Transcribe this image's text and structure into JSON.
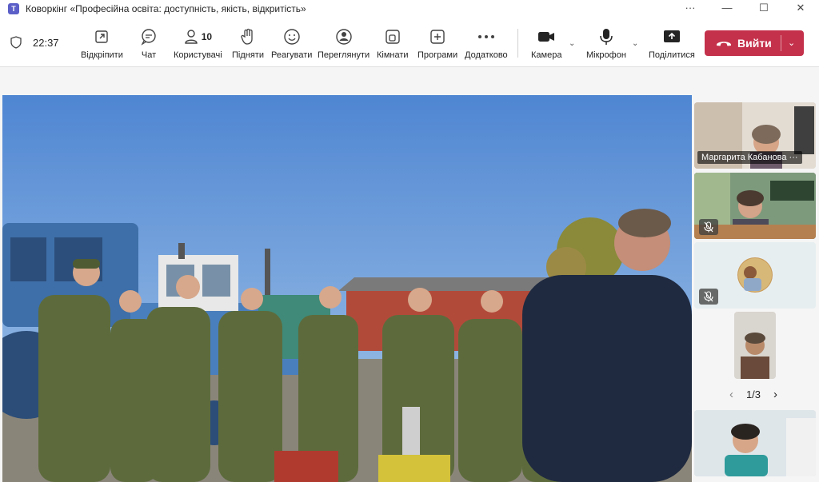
{
  "window": {
    "title": "Коворкінг «Професійна освіта: доступність, якість, відкритість»",
    "controls": [
      "···",
      "—",
      "☐",
      "✕"
    ]
  },
  "meeting": {
    "time": "22:37"
  },
  "toolbar": {
    "buttons": [
      {
        "label": "Відкріпити",
        "icon": "unpin-icon"
      },
      {
        "label": "Чат",
        "icon": "chat-icon"
      },
      {
        "label": "Користувачі",
        "icon": "people-icon",
        "count": "10"
      },
      {
        "label": "Підняти",
        "icon": "raise-hand-icon"
      },
      {
        "label": "Реагувати",
        "icon": "react-icon"
      },
      {
        "label": "Переглянути",
        "icon": "view-icon"
      },
      {
        "label": "Кімнати",
        "icon": "rooms-icon"
      },
      {
        "label": "Програми",
        "icon": "apps-icon"
      },
      {
        "label": "Додатково",
        "icon": "more-icon"
      },
      {
        "label": "Камера",
        "icon": "camera-icon"
      },
      {
        "label": "Мікрофон",
        "icon": "mic-icon"
      },
      {
        "label": "Поділитися",
        "icon": "share-icon"
      }
    ],
    "leave_label": "Вийти"
  },
  "participants": [
    {
      "name": "Маргарита Кабанова",
      "more": "···"
    },
    {
      "name": "",
      "muted": true
    },
    {
      "name": "",
      "muted": true
    },
    {
      "name": ""
    },
    {
      "name": ""
    }
  ],
  "pager": {
    "text": "1/3",
    "prev": "‹",
    "next": "›"
  },
  "colors": {
    "leave": "#c4314b",
    "accent": "#5b5fc7"
  }
}
